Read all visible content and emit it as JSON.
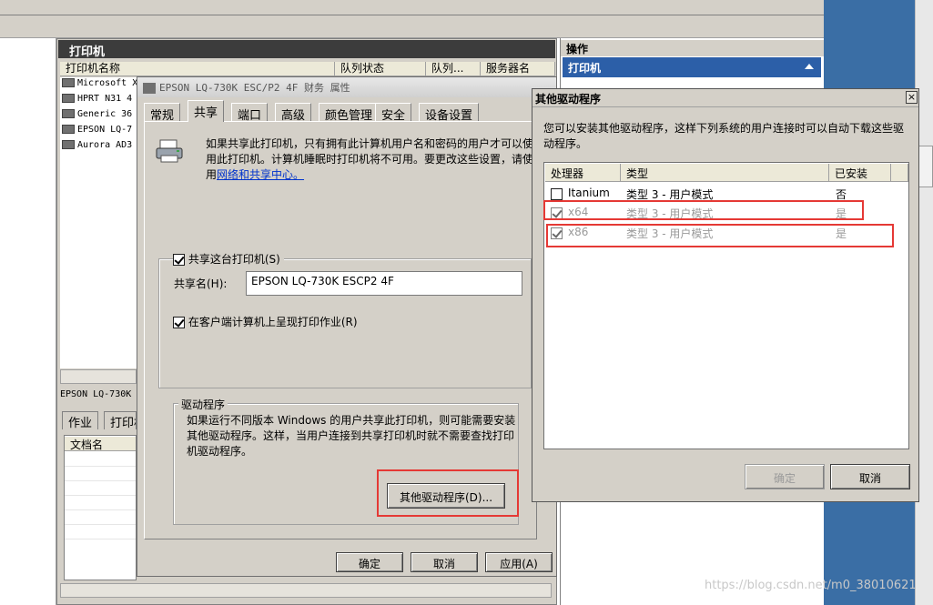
{
  "background": {
    "printer_panel_title": "打印机",
    "columns": [
      "打印机名称",
      "队列状态",
      "队列...",
      "服务器名"
    ],
    "printers": [
      "Microsoft XPS",
      "HPRT N31 4",
      "Generic 36",
      "EPSON LQ-7",
      "Aurora AD3"
    ],
    "actions_title": "操作",
    "actions_sub": "打印机",
    "selected_printer_short": "EPSON LQ-730K",
    "bottom_tabs": [
      "作业",
      "打印机"
    ],
    "doc_col": "文档名"
  },
  "props": {
    "title": "EPSON LQ-730K ESC/P2 4F 财务 属性",
    "tabs": [
      "常规",
      "共享",
      "端口",
      "高级",
      "颜色管理",
      "安全",
      "设备设置"
    ],
    "active_tab": "共享",
    "info_text": "如果共享此打印机，只有拥有此计算机用户名和密码的用户才可以使用此打印机。计算机睡眠时打印机将不可用。要更改这些设置，请使用",
    "info_link": "网络和共享中心。",
    "share_checkbox_label": "共享这台打印机(S)",
    "share_name_label": "共享名(H):",
    "share_name_value": "EPSON LQ-730K ESCP2 4F",
    "render_checkbox_label": "在客户端计算机上呈现打印作业(R)",
    "drivers_group_label": "驱动程序",
    "drivers_text": "如果运行不同版本 Windows 的用户共享此打印机，则可能需要安装其他驱动程序。这样，当用户连接到共享打印机时就不需要查找打印机驱动程序。",
    "other_drivers_button": "其他驱动程序(D)...",
    "ok_button": "确定",
    "cancel_button": "取消",
    "apply_button": "应用(A)"
  },
  "other_drivers": {
    "title": "其他驱动程序",
    "close_glyph": "×",
    "description": "您可以安装其他驱动程序，这样下列系统的用户连接时可以自动下载这些驱动程序。",
    "columns": [
      "处理器",
      "类型",
      "已安装"
    ],
    "rows": [
      {
        "processor": "Itanium",
        "type": "类型 3 - 用户模式",
        "installed": "否",
        "checked": false,
        "disabled": false
      },
      {
        "processor": "x64",
        "type": "类型 3 - 用户模式",
        "installed": "是",
        "checked": true,
        "disabled": true
      },
      {
        "processor": "x86",
        "type": "类型 3 - 用户模式",
        "installed": "是",
        "checked": true,
        "disabled": true
      }
    ],
    "ok_button": "确定",
    "cancel_button": "取消"
  },
  "watermark": "https://blog.csdn.net/m0_38010621",
  "colors": {
    "highlight_red": "#e53935",
    "action_blue": "#2c5fa8",
    "desktop_blue": "#3a6ea5"
  }
}
